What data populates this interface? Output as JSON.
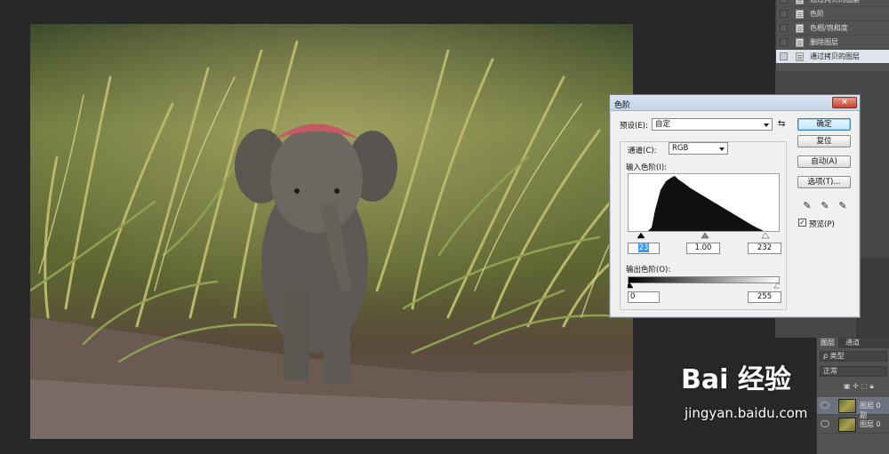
{
  "history_panel": {
    "items": [
      {
        "label": "通过拷贝的图层",
        "active": false
      },
      {
        "label": "色阶",
        "active": false
      },
      {
        "label": "色相/饱和度",
        "active": false
      },
      {
        "label": "删除图层",
        "active": false
      },
      {
        "label": "通过拷贝的图层",
        "active": true
      }
    ]
  },
  "levels_dialog": {
    "title": "色阶",
    "close_symbol": "×",
    "preset_label": "预设(E):",
    "preset_value": "自定",
    "channel_label": "通道(C):",
    "channel_value": "RGB",
    "input_levels_label": "输入色阶(I):",
    "input_black": "23",
    "input_gamma": "1.00",
    "input_white": "232",
    "output_levels_label": "输出色阶(O):",
    "output_black": "0",
    "output_white": "255",
    "buttons": {
      "ok": "确定",
      "reset": "复位",
      "auto": "自动(A)",
      "options": "选项(T)..."
    },
    "preview_label": "预览(P)",
    "preview_checked": true
  },
  "layers_panel": {
    "tabs": [
      "图层",
      "通道"
    ],
    "filter_label": "ρ 类型",
    "blend_mode": "正常",
    "layers": [
      {
        "name": "图层 0 副"
      },
      {
        "name": "图层 0"
      }
    ]
  },
  "watermark": {
    "logo": "Bai 经验",
    "url": "jingyan.baidu.com"
  }
}
